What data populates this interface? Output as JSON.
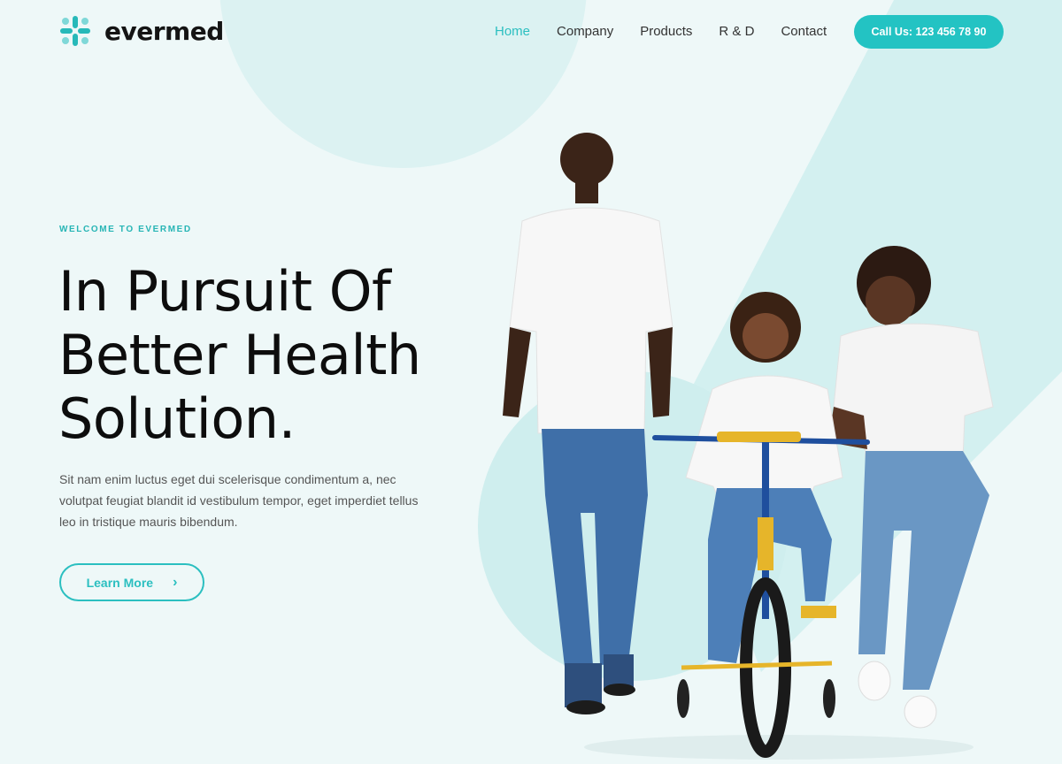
{
  "brand": {
    "name": "evermed",
    "logo_icon": "cross-dots-logo-icon"
  },
  "nav": {
    "items": [
      {
        "label": "Home",
        "active": true
      },
      {
        "label": "Company",
        "active": false
      },
      {
        "label": "Products",
        "active": false
      },
      {
        "label": "R & D",
        "active": false
      },
      {
        "label": "Contact",
        "active": false
      }
    ],
    "cta_label": "Call Us: 123 456 78 90"
  },
  "hero": {
    "eyebrow": "WELCOME TO EVERMED",
    "headline_lines": [
      "In Pursuit Of",
      "Better Health",
      "Solution."
    ],
    "description": "Sit nam enim luctus eget dui scelerisque condimentum a, nec volutpat feugiat blandit id vestibulum tempor, eget imperdiet tellus leo in tristique mauris bibendum.",
    "button_label": "Learn More",
    "button_icon": "chevron-right-icon"
  },
  "colors": {
    "accent": "#23c3c3",
    "background": "#eef8f8",
    "shape": "#d3f0f0"
  },
  "image": {
    "subject": "family-child-bicycle-photo"
  }
}
